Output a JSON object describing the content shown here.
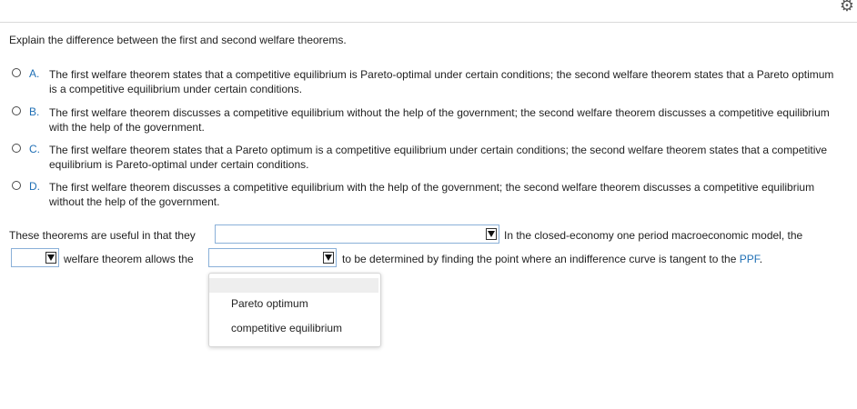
{
  "question": "Explain the difference between the first and second welfare theorems.",
  "options": [
    {
      "letter": "A.",
      "text": "The first welfare theorem states that a competitive equilibrium is Pareto-optimal under certain conditions; the second welfare theorem states that a Pareto optimum is a competitive equilibrium under certain conditions."
    },
    {
      "letter": "B.",
      "text": "The first welfare theorem discusses a competitive equilibrium without the help of the government; the second welfare theorem discusses a competitive equilibrium with the help of the government."
    },
    {
      "letter": "C.",
      "text": "The first welfare theorem states that a Pareto optimum is a competitive equilibrium under certain conditions; the second welfare theorem states that a competitive equilibrium is Pareto-optimal under certain conditions."
    },
    {
      "letter": "D.",
      "text": "The first welfare theorem discusses a competitive equilibrium with the help of the government; the second welfare theorem discusses a competitive equilibrium without the help of the government."
    }
  ],
  "fill": {
    "line1_prefix": "These theorems are useful in that they",
    "line1_suffix": "In the closed-economy one period macroeconomic model, the",
    "line2_mid": "welfare theorem allows the",
    "line2_suffix": "to be determined by finding the point where an indifference curve is tangent to the",
    "ppf": "PPF",
    "period": ".",
    "select1_value": "",
    "select2_value": "",
    "select3_value": ""
  },
  "dropdown": {
    "options": [
      "",
      "Pareto optimum",
      "competitive equilibrium"
    ]
  },
  "icons": {
    "settings": "gear-icon"
  },
  "colors": {
    "accent": "#1f6fb5",
    "select_border": "#8ab0d8"
  }
}
